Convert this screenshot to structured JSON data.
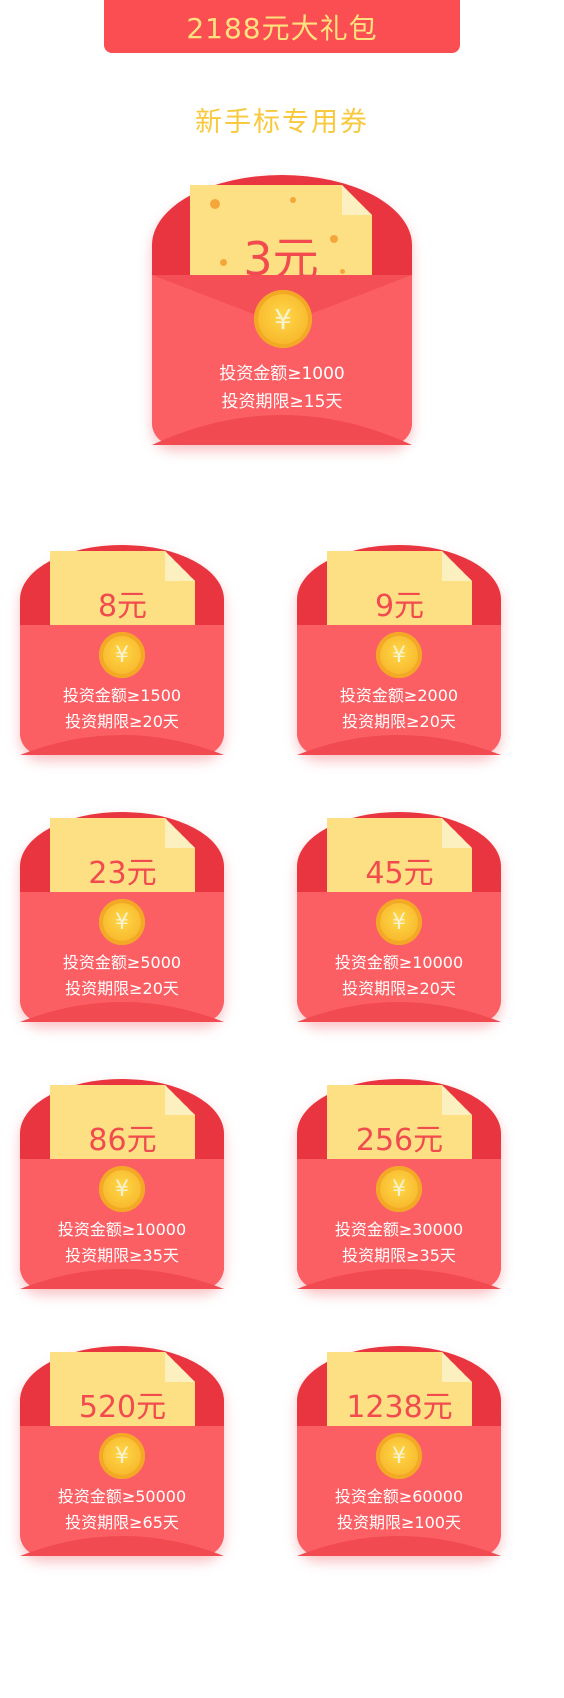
{
  "header": {
    "title": "2188元大礼包"
  },
  "section": {
    "subtitle": "新手标专用券"
  },
  "featured": {
    "amount": "3元",
    "currency_icon": "yen-coin-icon",
    "line1": "投资金额≥1000",
    "line2": "投资期限≥15天"
  },
  "coupons": [
    {
      "amount": "8元",
      "line1": "投资金额≥1500",
      "line2": "投资期限≥20天"
    },
    {
      "amount": "9元",
      "line1": "投资金额≥2000",
      "line2": "投资期限≥20天"
    },
    {
      "amount": "23元",
      "line1": "投资金额≥5000",
      "line2": "投资期限≥20天"
    },
    {
      "amount": "45元",
      "line1": "投资金额≥10000",
      "line2": "投资期限≥20天"
    },
    {
      "amount": "86元",
      "line1": "投资金额≥10000",
      "line2": "投资期限≥35天"
    },
    {
      "amount": "256元",
      "line1": "投资金额≥30000",
      "line2": "投资期限≥35天"
    },
    {
      "amount": "520元",
      "line1": "投资金额≥50000",
      "line2": "投资期限≥65天"
    },
    {
      "amount": "1238元",
      "line1": "投资金额≥60000",
      "line2": "投资期限≥100天"
    }
  ],
  "coin_symbol": "¥",
  "colors": {
    "banner": "#fb4e52",
    "banner_text": "#ffe27f",
    "subtitle": "#f9c93d",
    "envelope_back": "#e9353f",
    "envelope_front": "#fb5f64",
    "card": "#fde083",
    "amount": "#f14a4f",
    "coin": "#f7b62a"
  }
}
